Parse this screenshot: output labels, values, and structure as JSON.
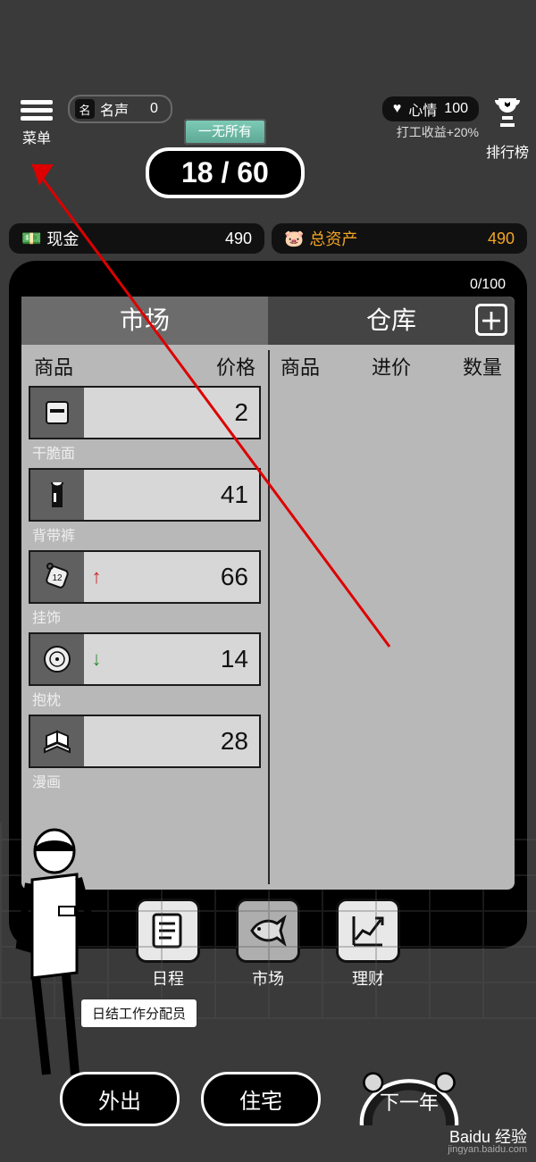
{
  "hud": {
    "menu_label": "菜单",
    "reputation_label": "名声",
    "reputation_value": "0",
    "status_badge": "一无所有",
    "day_counter": "18 / 60",
    "mood_label": "心情",
    "mood_value": "100",
    "work_bonus": "打工收益+20%",
    "rank_label": "排行榜"
  },
  "resources": {
    "cash_label": "现金",
    "cash_value": "490",
    "assets_label": "总资产",
    "assets_value": "490"
  },
  "inventory": {
    "capacity": "0/100",
    "market_tab": "市场",
    "warehouse_tab": "仓库",
    "market_header_item": "商品",
    "market_header_price": "价格",
    "warehouse_header_item": "商品",
    "warehouse_header_cost": "进价",
    "warehouse_header_qty": "数量",
    "items": [
      {
        "name": "干脆面",
        "price": "2",
        "trend": ""
      },
      {
        "name": "背带裤",
        "price": "41",
        "trend": ""
      },
      {
        "name": "挂饰",
        "price": "66",
        "trend": "up"
      },
      {
        "name": "抱枕",
        "price": "14",
        "trend": "down"
      },
      {
        "name": "漫画",
        "price": "28",
        "trend": ""
      }
    ]
  },
  "nav": {
    "schedule": "日程",
    "market": "市场",
    "finance": "理财"
  },
  "character": {
    "job_title": "日结工作分配员"
  },
  "bottom": {
    "go_out": "外出",
    "home": "住宅",
    "next_year": "下一年"
  },
  "watermark": {
    "brand": "Baidu 经验",
    "url": "jingyan.baidu.com"
  }
}
